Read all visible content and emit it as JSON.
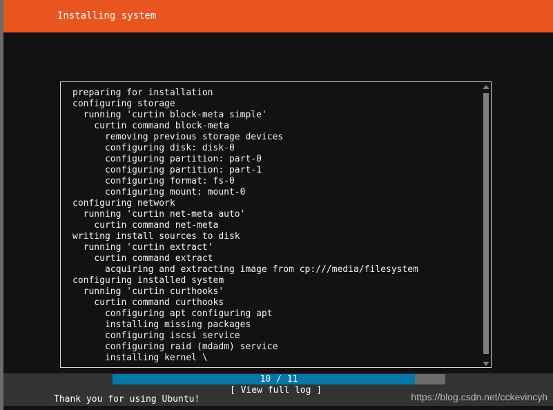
{
  "header": {
    "title": "Installing system",
    "bg_color": "#e8551f",
    "text_color": "#ffffff"
  },
  "left_gutter": {
    "color": "#6b6b6b"
  },
  "log_box": {
    "border_color": "#d6d6d6",
    "bg_color": "#121212",
    "text_color": "#f2f2f2",
    "lines": [
      "preparing for installation",
      "configuring storage",
      "  running 'curtin block-meta simple'",
      "    curtin command block-meta",
      "      removing previous storage devices",
      "      configuring disk: disk-0",
      "      configuring partition: part-0",
      "      configuring partition: part-1",
      "      configuring format: fs-0",
      "      configuring mount: mount-0",
      "configuring network",
      "  running 'curtin net-meta auto'",
      "    curtin command net-meta",
      "writing install sources to disk",
      "  running 'curtin extract'",
      "    curtin command extract",
      "      acquiring and extracting image from cp:///media/filesystem",
      "configuring installed system",
      "  running 'curtin curthooks'",
      "    curtin command curthooks",
      "      configuring apt configuring apt",
      "      installing missing packages",
      "      configuring iscsi service",
      "      configuring raid (mdadm) service",
      "      installing kernel \\"
    ]
  },
  "scrollbar": {
    "up_arrow": "scroll-up-arrow-icon",
    "down_arrow": "scroll-down-arrow-icon",
    "thumb_color": "#7e7e7e",
    "arrow_color": "#7a7a7a"
  },
  "actions": {
    "view_full_log": "[ View full log ]"
  },
  "progress": {
    "label": "10 / 11",
    "current": 10,
    "total": 11,
    "fill_color": "#0477a8",
    "track_color": "#6b6b6b"
  },
  "footer": {
    "message": "Thank you for using Ubuntu!",
    "bg_color": "#333333"
  },
  "watermark": {
    "text": "https://blog.csdn.net/cckevincyh",
    "color": "#b9b9b9"
  }
}
